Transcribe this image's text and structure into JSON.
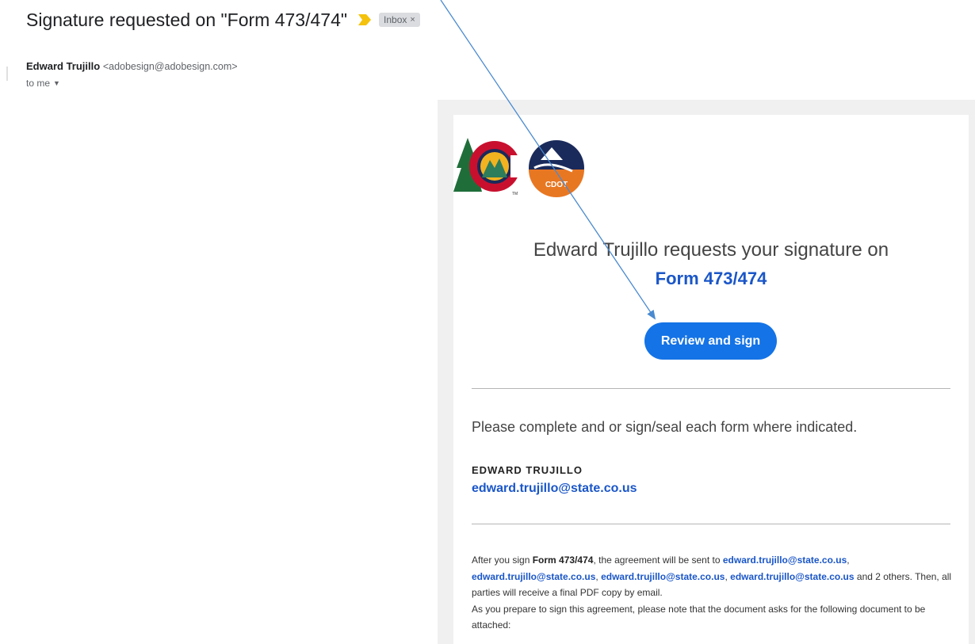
{
  "email": {
    "subject": "Signature requested on \"Form 473/474\"",
    "label": "Inbox",
    "label_close": "×",
    "sender_name": "Edward Trujillo",
    "sender_email": "<adobesign@adobesign.com>",
    "recipient": "to me"
  },
  "body": {
    "logo_text": "CDOT",
    "logo_tm": "TM",
    "request_line": "Edward Trujillo requests your signature on",
    "form_title": "Form 473/474",
    "review_button": "Review and sign",
    "message": "Please complete and or sign/seal each form where indicated.",
    "signer_name": "EDWARD TRUJILLO",
    "signer_email": "edward.trujillo@state.co.us",
    "footer": {
      "p1_prefix": "After you sign ",
      "p1_form": "Form 473/474",
      "p1_mid": ", the agreement will be sent to ",
      "recipients": [
        "edward.trujillo@state.co.us",
        "edward.trujillo@state.co.us",
        "edward.trujillo@state.co.us",
        "edward.trujillo@state.co.us"
      ],
      "sep": ", ",
      "p1_suffix": " and 2 others. Then, all parties will receive a final PDF copy by email.",
      "p2": "As you prepare to sign this agreement, please note that the document asks for the following document to be attached:"
    }
  },
  "colors": {
    "accent_blue": "#1473e6",
    "link_blue": "#1a56c8",
    "importance_yellow": "#f4c20d"
  },
  "icons": {
    "importance": "importance-marker-icon",
    "dropdown": "caret-down-icon",
    "close": "close-icon"
  }
}
